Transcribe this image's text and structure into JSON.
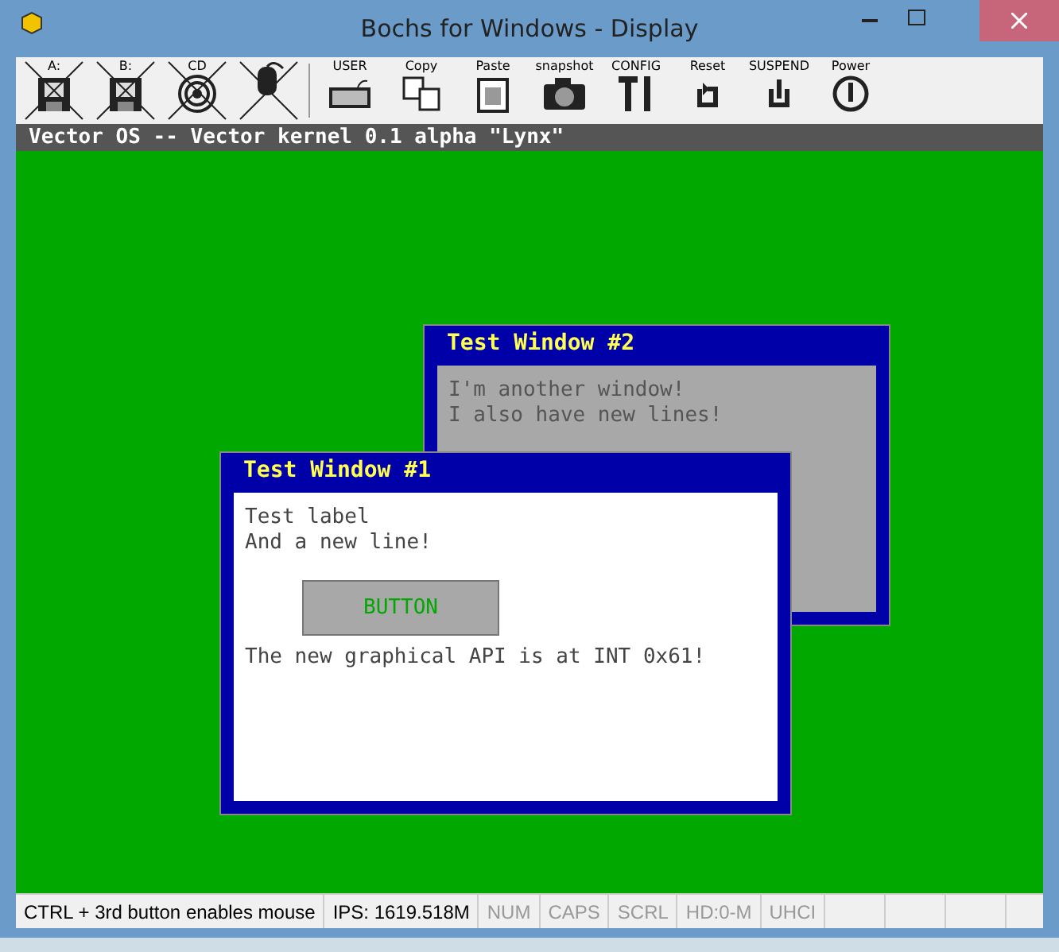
{
  "window": {
    "title": "Bochs for Windows - Display"
  },
  "toolbar": [
    {
      "kind": "floppy",
      "label": "A:",
      "disabled": true
    },
    {
      "kind": "floppy",
      "label": "B:",
      "disabled": true
    },
    {
      "kind": "cdrom",
      "label": "CD",
      "disabled": true
    },
    {
      "kind": "mouse",
      "disabled": true
    },
    {
      "kind": "keyboard",
      "label": "USER",
      "disabled": false
    },
    {
      "kind": "copy",
      "label": "Copy",
      "disabled": false
    },
    {
      "kind": "paste",
      "label": "Paste",
      "disabled": false
    },
    {
      "kind": "camera",
      "label": "snapshot",
      "disabled": false
    },
    {
      "kind": "config",
      "label": "CONFIG",
      "disabled": false
    },
    {
      "kind": "reset",
      "label": "Reset",
      "disabled": false
    },
    {
      "kind": "suspend",
      "label": "SUSPEND",
      "disabled": false
    },
    {
      "kind": "power",
      "label": "Power",
      "disabled": false
    }
  ],
  "header": "Vector OS -- Vector kernel 0.1 alpha \"Lynx\"",
  "windows": [
    {
      "title": "Test Window #2",
      "lines": [
        "I'm another window!",
        "I also have new lines!"
      ]
    },
    {
      "title": "Test Window #1",
      "lines": [
        "Test label",
        "And a new line!"
      ],
      "button": "BUTTON",
      "footer": "The new graphical API is at INT 0x61!"
    }
  ],
  "status_bar": [
    {
      "text": "CTRL + 3rd button enables mouse",
      "active": true
    },
    {
      "text": "IPS: 1619.518M",
      "active": true
    },
    {
      "text": "NUM",
      "active": false
    },
    {
      "text": "CAPS",
      "active": false
    },
    {
      "text": "SCRL",
      "active": false
    },
    {
      "text": "HD:0-M",
      "active": false
    },
    {
      "text": "UHCI",
      "active": false
    }
  ]
}
